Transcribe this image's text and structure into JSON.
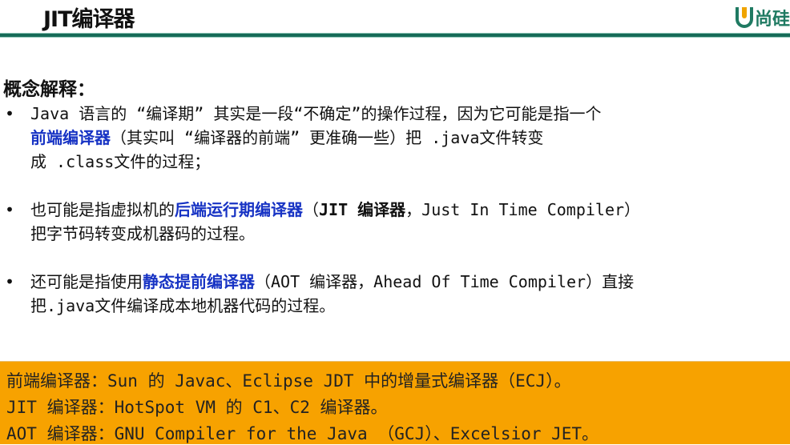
{
  "header": {
    "title": "JIT编译器",
    "logo_text": "尚硅"
  },
  "section_title": "概念解释：",
  "bullets": [
    {
      "lines": [
        [
          {
            "t": "Java 语言的 “编译期” 其实是一段“不确定”的操作过程，因为它可能是指一个"
          }
        ],
        [
          {
            "t": "前端编译器",
            "s": "hl"
          },
          {
            "t": "（其实叫 “编译器的前端” 更准确一些）把 .java文件转变"
          }
        ],
        [
          {
            "t": "成 .class文件的过程；"
          }
        ]
      ]
    },
    {
      "lines": [
        [
          {
            "t": "也可能是指虚拟机的"
          },
          {
            "t": "后端运行期编译器",
            "s": "hl"
          },
          {
            "t": "（"
          },
          {
            "t": "JIT 编译器",
            "s": "bd"
          },
          {
            "t": "，Just In Time Compiler）"
          }
        ],
        [
          {
            "t": "把字节码转变成机器码的过程。"
          }
        ]
      ]
    },
    {
      "lines": [
        [
          {
            "t": "还可能是指使用"
          },
          {
            "t": "静态提前编译器",
            "s": "hl"
          },
          {
            "t": "（AOT 编译器，Ahead Of Time Compiler）直接"
          }
        ],
        [
          {
            "t": "把.java文件编译成本地机器代码的过程。"
          }
        ]
      ]
    }
  ],
  "bullet_symbol": "•",
  "summary_box": {
    "color": "#f7a200",
    "lines": [
      "前端编译器：Sun 的 Javac、Eclipse JDT 中的增量式编译器（ECJ）。",
      "JIT 编译器：HotSpot VM 的 C1、C2 编译器。",
      "AOT 编译器：GNU Compiler for the Java （GCJ）、Excelsior JET。"
    ]
  }
}
